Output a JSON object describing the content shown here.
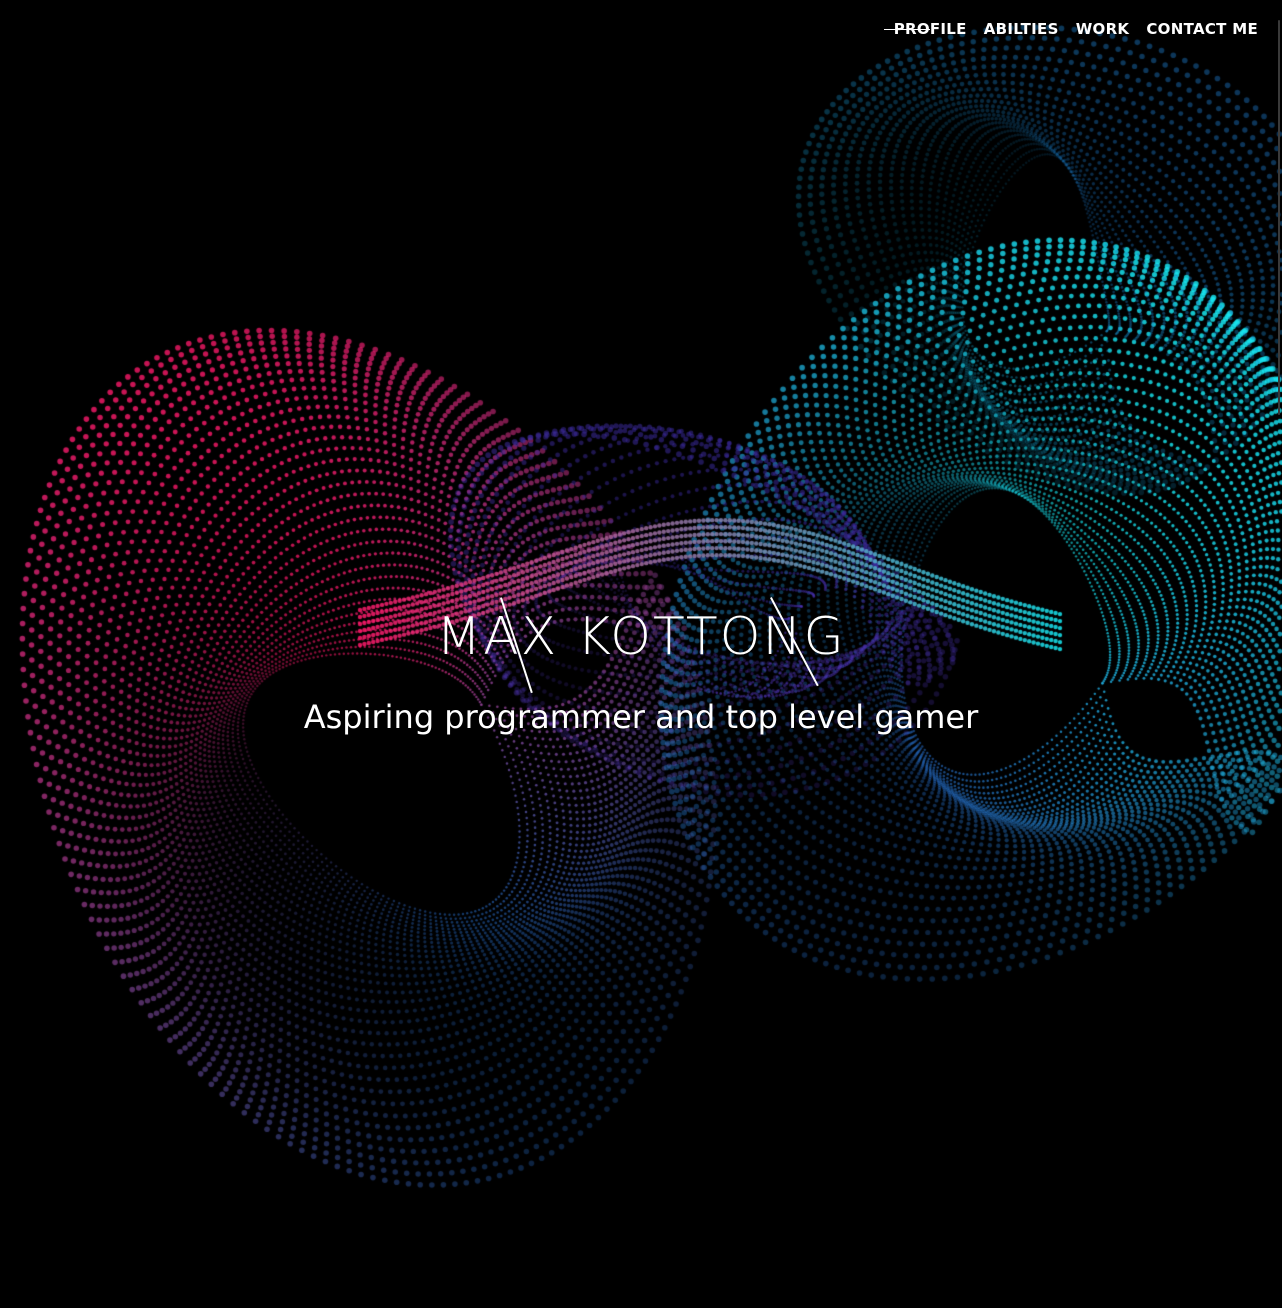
{
  "nav": {
    "items": [
      {
        "label": "PROFILE",
        "active": true
      },
      {
        "label": "ABILTIES"
      },
      {
        "label": "WORK"
      },
      {
        "label": "CONTACT ME"
      }
    ]
  },
  "hero": {
    "title": "MAX KOTTONG",
    "subtitle": "Aspiring programmer and top level gamer"
  },
  "colors": {
    "background": "#000000",
    "accent_pink": "#ff1a6b",
    "accent_cyan": "#18e6f0",
    "accent_purple": "#3a2a9a",
    "text": "#ffffff"
  }
}
